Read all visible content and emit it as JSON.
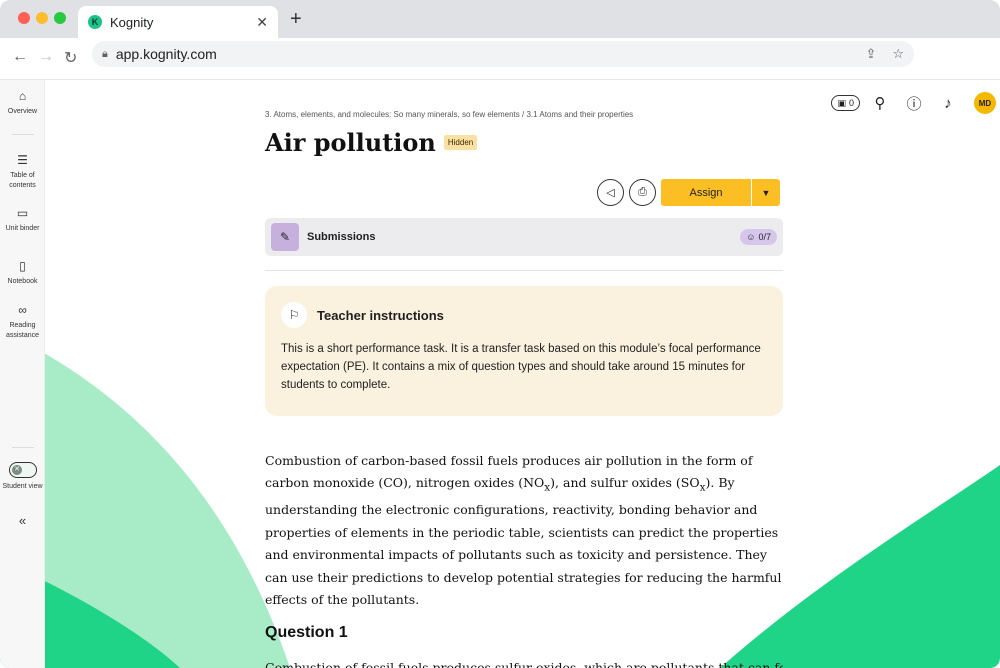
{
  "browser": {
    "tab_title": "Kognity",
    "url": "app.kognity.com",
    "tab_close": "✕",
    "new_tab": "+"
  },
  "sidebar": {
    "items": [
      {
        "label": "Overview",
        "icon": "home-icon"
      },
      {
        "label": "Table of contents",
        "icon": "list-icon"
      },
      {
        "label": "Unit binder",
        "icon": "folder-icon"
      },
      {
        "label": "Notebook",
        "icon": "notebook-icon"
      },
      {
        "label": "Reading assistance",
        "icon": "glasses-icon"
      }
    ],
    "student_view_label": "Student view",
    "collapse_icon": "«"
  },
  "topbar": {
    "counter": "0"
  },
  "avatar_initials": "MD",
  "breadcrumb": "3. Atoms, elements, and molecules: So many minerals, so few elements / 3.1 Atoms and their properties",
  "page_title": "Air pollution",
  "hidden_badge": "Hidden",
  "assign_label": "Assign",
  "submissions": {
    "label": "Submissions",
    "count": "0/7"
  },
  "teacher_instructions": {
    "title": "Teacher instructions",
    "text": "This is a short performance task. It is a transfer task based on this module’s focal performance expectation (PE). It contains a mix of question types and should take around 15 minutes for students to complete."
  },
  "body": {
    "p1": "Combustion of carbon-based fossil fuels produces air pollution in the form of carbon monoxide (CO), nitrogen oxides (NO",
    "sub1": "x",
    "p2": "), and sulfur oxides (SO",
    "sub2": "x",
    "p3": "). By understanding the electronic configurations, reactivity, bonding behavior and properties of elements in the periodic table, scientists can predict the properties and environmental impacts of pollutants such as toxicity and persistence. They can use their predictions to develop potential strategies for reducing the harmful effects of the pollutants."
  },
  "question_heading": "Question 1",
  "cutoff_text": "Combustion of fossil fuels produces sulfur oxides, which are pollutants that can form sulfuric",
  "colors": {
    "brand_green": "#1dc48a",
    "assign_yellow": "#fbbf24",
    "teacher_box": "#faf1de"
  }
}
